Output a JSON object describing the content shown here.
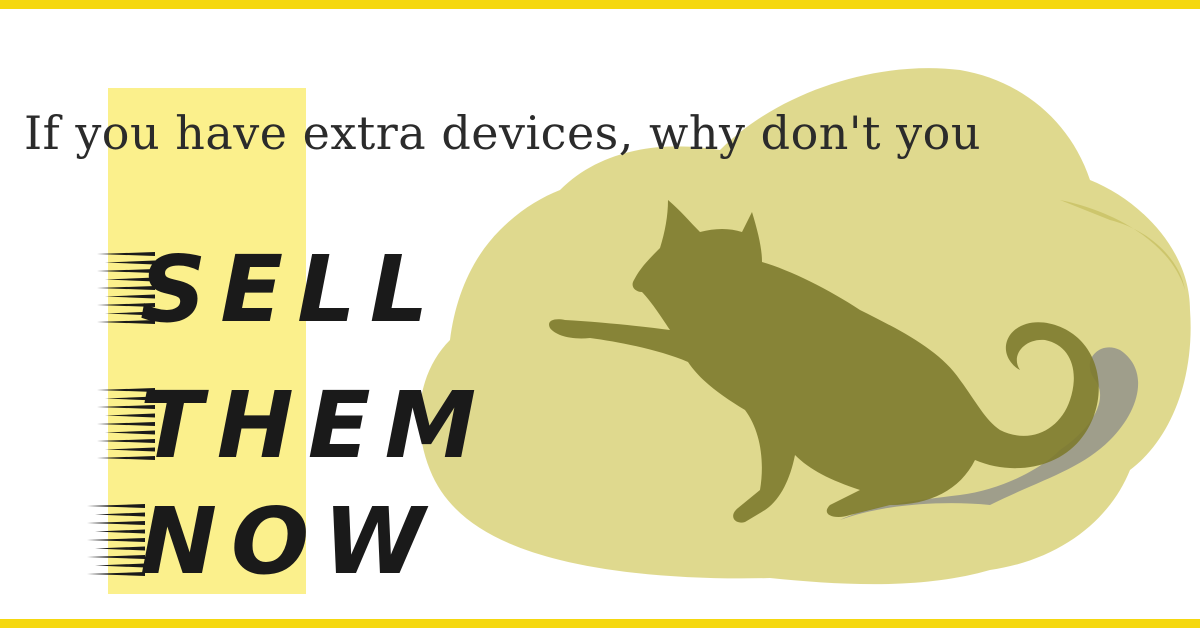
{
  "headline": "If you have extra devices, why don't you",
  "cta": {
    "line1": "SELL",
    "line2": "THEM",
    "line3": "NOW"
  },
  "colors": {
    "frame": "#f5d80f",
    "highlight": "#fbf08c",
    "watercolor": "#d9d27a",
    "watercolor_dark": "#c4bd5e",
    "cat": "#7d7a2e",
    "cat_shadow": "#8a8a8a",
    "text": "#2b2b2b",
    "cta_text": "#1a1a1a"
  }
}
